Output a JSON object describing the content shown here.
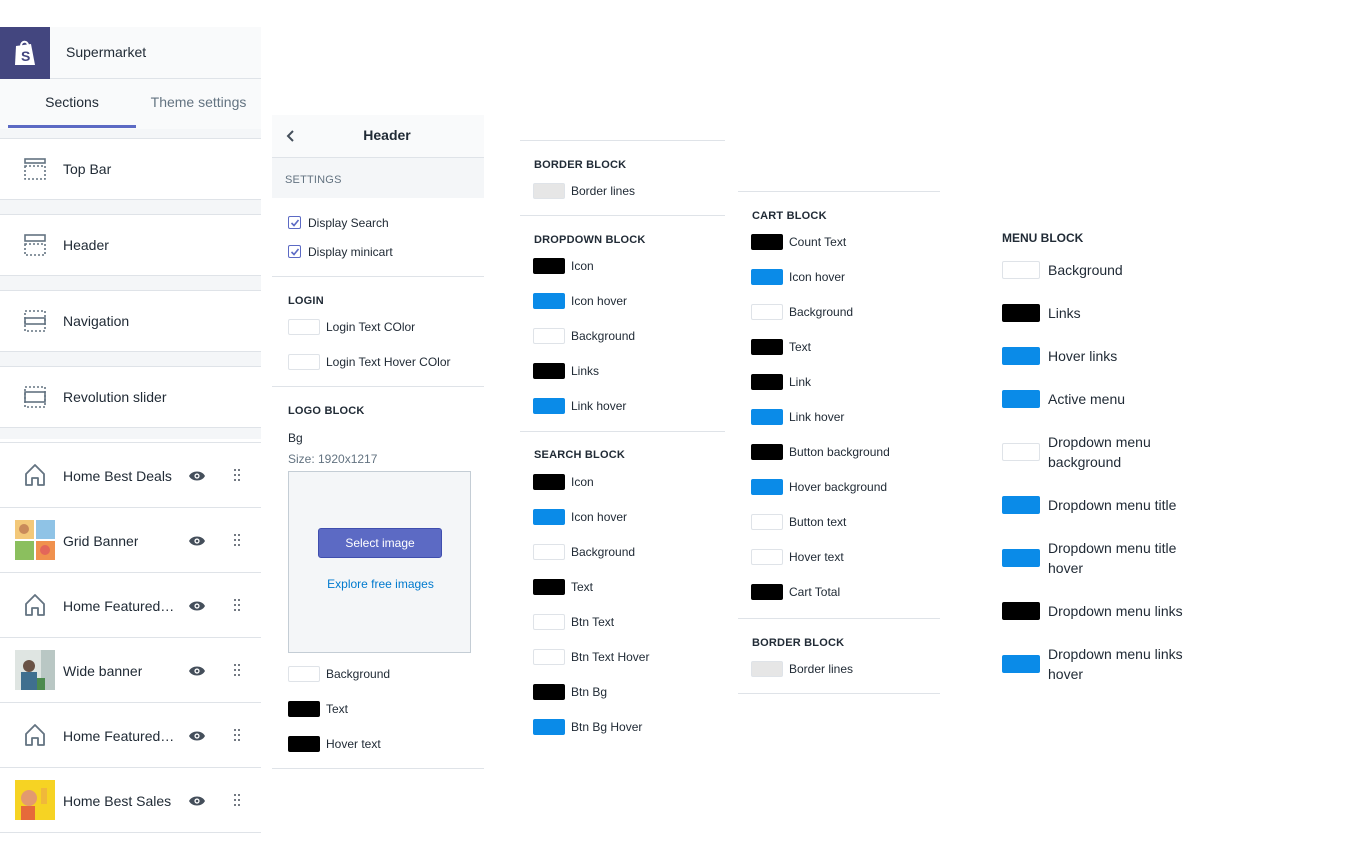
{
  "colors": {
    "accent": "#5c6ac4",
    "black": "#000000",
    "blue": "#0a8be8",
    "white": "#ffffff",
    "grey": "#e6e6e6",
    "link": "#007ace"
  },
  "sidebar": {
    "store_name": "Supermarket",
    "tabs": [
      {
        "label": "Sections",
        "active": true
      },
      {
        "label": "Theme settings",
        "active": false
      }
    ],
    "sections": [
      {
        "label": "Top Bar"
      },
      {
        "label": "Header"
      },
      {
        "label": "Navigation"
      },
      {
        "label": "Revolution slider"
      }
    ],
    "blocks": [
      {
        "label": "Home Best Deals",
        "icon": "home-icon"
      },
      {
        "label": "Grid Banner",
        "icon": "grid-banner-thumbnail"
      },
      {
        "label": "Home Featured ...",
        "icon": "home-icon"
      },
      {
        "label": "Wide banner",
        "icon": "wide-banner-thumbnail"
      },
      {
        "label": "Home Featured ...",
        "icon": "home-icon"
      },
      {
        "label": "Home Best Sales",
        "icon": "best-sales-thumbnail"
      }
    ]
  },
  "header_panel": {
    "title": "Header",
    "settings_caption": "SETTINGS",
    "checkboxes": [
      {
        "label": "Display Search",
        "checked": true
      },
      {
        "label": "Display minicart",
        "checked": true
      }
    ],
    "login_caption": "LOGIN",
    "login_colors": [
      {
        "label": "Login Text COlor",
        "color": "#ffffff"
      },
      {
        "label": "Login Text Hover COlor",
        "color": "#ffffff"
      }
    ],
    "logo_caption": "LOGO BLOCK",
    "bg_label": "Bg",
    "size_label": "Size: 1920x1217",
    "select_image": "Select image",
    "explore_images": "Explore free images",
    "logo_colors": [
      {
        "label": "Background",
        "color": "#ffffff"
      },
      {
        "label": "Text",
        "color": "#000000"
      },
      {
        "label": "Hover text",
        "color": "#000000"
      }
    ]
  },
  "col2": {
    "border_caption": "BORDER BLOCK",
    "border_item": {
      "label": "Border lines",
      "color": "#e6e6e6"
    },
    "dropdown_caption": "DROPDOWN BLOCK",
    "dropdown_items": [
      {
        "label": "Icon",
        "color": "#000000"
      },
      {
        "label": "Icon hover",
        "color": "#0a8be8"
      },
      {
        "label": "Background",
        "color": "#ffffff"
      },
      {
        "label": "Links",
        "color": "#000000"
      },
      {
        "label": "Link hover",
        "color": "#0a8be8"
      }
    ],
    "search_caption": "SEARCH BLOCK",
    "search_items": [
      {
        "label": "Icon",
        "color": "#000000"
      },
      {
        "label": "Icon hover",
        "color": "#0a8be8"
      },
      {
        "label": "Background",
        "color": "#ffffff"
      },
      {
        "label": "Text",
        "color": "#000000"
      },
      {
        "label": "Btn Text",
        "color": "#ffffff"
      },
      {
        "label": "Btn Text Hover",
        "color": "#ffffff"
      },
      {
        "label": "Btn Bg",
        "color": "#000000"
      },
      {
        "label": "Btn Bg Hover",
        "color": "#0a8be8"
      }
    ]
  },
  "col3": {
    "cart_caption": "CART BLOCK",
    "cart_items": [
      {
        "label": "Count Text",
        "color": "#000000"
      },
      {
        "label": "Icon hover",
        "color": "#0a8be8"
      },
      {
        "label": "Background",
        "color": "#ffffff"
      },
      {
        "label": "Text",
        "color": "#000000"
      },
      {
        "label": "Link",
        "color": "#000000"
      },
      {
        "label": "Link hover",
        "color": "#0a8be8"
      },
      {
        "label": "Button background",
        "color": "#000000"
      },
      {
        "label": "Hover background",
        "color": "#0a8be8"
      },
      {
        "label": "Button text",
        "color": "#ffffff"
      },
      {
        "label": "Hover text",
        "color": "#ffffff"
      },
      {
        "label": "Cart Total",
        "color": "#000000"
      }
    ],
    "border_caption": "BORDER BLOCK",
    "border_item": {
      "label": "Border lines",
      "color": "#e6e6e6"
    }
  },
  "menu": {
    "caption": "MENU BLOCK",
    "items": [
      {
        "label": "Background",
        "color": "#ffffff"
      },
      {
        "label": "Links",
        "color": "#000000"
      },
      {
        "label": "Hover links",
        "color": "#0a8be8"
      },
      {
        "label": "Active menu",
        "color": "#0a8be8"
      },
      {
        "label": "Dropdown menu background",
        "color": "#ffffff"
      },
      {
        "label": "Dropdown menu title",
        "color": "#0a8be8"
      },
      {
        "label": "Dropdown menu title hover",
        "color": "#0a8be8"
      },
      {
        "label": "Dropdown menu links",
        "color": "#000000"
      },
      {
        "label": "Dropdown menu links hover",
        "color": "#0a8be8"
      }
    ]
  }
}
